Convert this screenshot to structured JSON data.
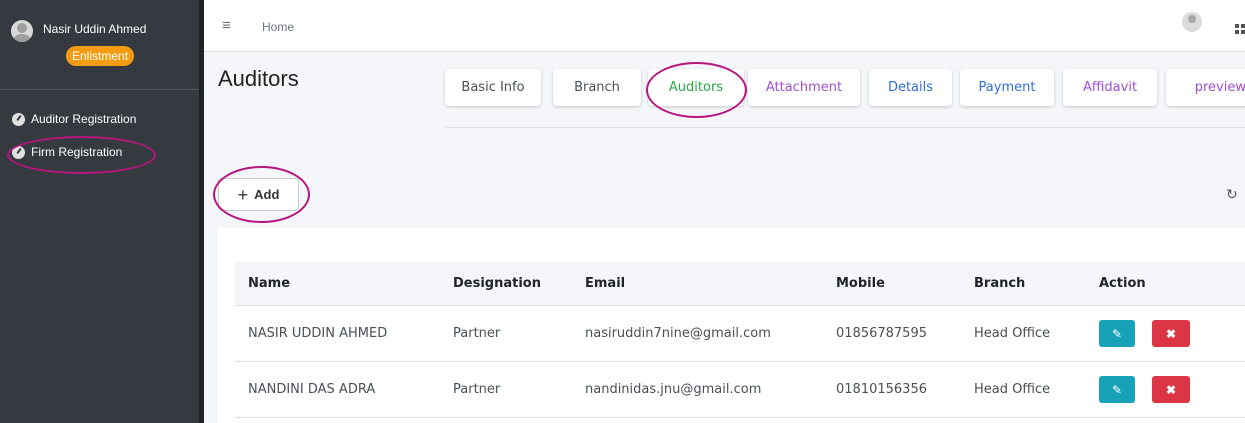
{
  "sidebar": {
    "user_name": "Nasir Uddin Ahmed",
    "badge": "Enlistment",
    "items": [
      {
        "label": "Auditor Registration",
        "icon": "dashboard-gauge-icon"
      },
      {
        "label": "Firm Registration",
        "icon": "dashboard-gauge-icon"
      }
    ]
  },
  "topbar": {
    "menu_icon": "≡",
    "breadcrumb": "Home"
  },
  "page": {
    "title": "Auditors",
    "tabs": [
      {
        "label": "Basic Info",
        "color": "#495057"
      },
      {
        "label": "Branch",
        "color": "#495057"
      },
      {
        "label": "Auditors",
        "color": "#28a745"
      },
      {
        "label": "Attachment",
        "color": "#a14fd1"
      },
      {
        "label": "Details",
        "color": "#2f6fd6"
      },
      {
        "label": "Payment",
        "color": "#2f6fd6"
      },
      {
        "label": "Affidavit",
        "color": "#a14fd1"
      },
      {
        "label": "preview",
        "color": "#a14fd1"
      }
    ],
    "add_button": {
      "icon": "+",
      "label": "Add"
    },
    "refresh_icon": "↻"
  },
  "table": {
    "columns": [
      "Name",
      "Designation",
      "Email",
      "Mobile",
      "Branch",
      "Action"
    ],
    "rows": [
      {
        "name": "NASIR UDDIN AHMED",
        "designation": "Partner",
        "email": "nasiruddin7nine@gmail.com",
        "mobile": "01856787595",
        "branch": "Head Office"
      },
      {
        "name": "NANDINI DAS ADRA",
        "designation": "Partner",
        "email": "nandinidas.jnu@gmail.com",
        "mobile": "01810156356",
        "branch": "Head Office"
      }
    ],
    "edit_icon": "✎",
    "delete_icon": "✖"
  },
  "colors": {
    "sidebar_bg": "#343a40",
    "badge": "#f39c12",
    "annotation": "#b8157d",
    "edit_button": "#17a2b8",
    "delete_button": "#dc3545"
  }
}
